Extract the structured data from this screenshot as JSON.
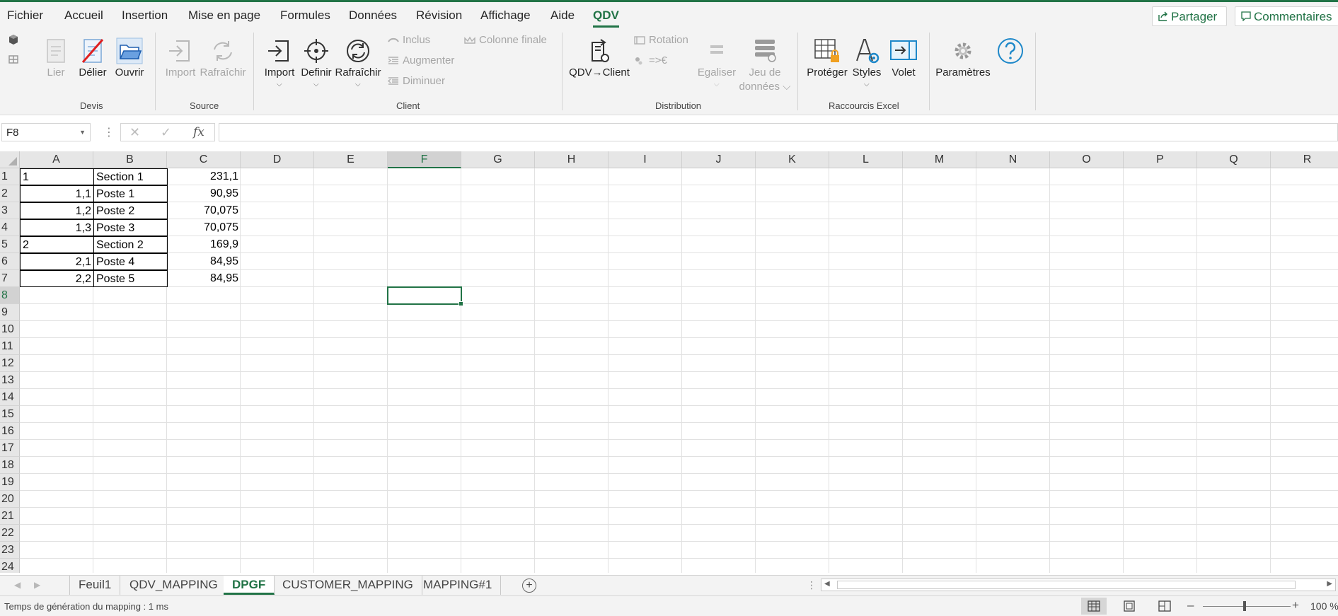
{
  "menubar": {
    "tabs": [
      "Fichier",
      "Accueil",
      "Insertion",
      "Mise en page",
      "Formules",
      "Données",
      "Révision",
      "Affichage",
      "Aide",
      "QDV"
    ],
    "active_tab": "QDV",
    "share_label": "Partager",
    "comments_label": "Commentaires"
  },
  "ribbon": {
    "groups": {
      "devis": "Devis",
      "source": "Source",
      "client": "Client",
      "distribution": "Distribution",
      "raccourcis": "Raccourcis Excel"
    },
    "buttons": {
      "lier": "Lier",
      "delier": "Délier",
      "ouvrir": "Ouvrir",
      "import_source": "Import",
      "rafraichir_source": "Rafraîchir",
      "import_client": "Import",
      "definir": "Definir",
      "rafraichir_client": "Rafraîchir",
      "inclus": "Inclus",
      "augmenter": "Augmenter",
      "diminuer": "Diminuer",
      "colonne_finale": "Colonne finale",
      "qdv_client": "QDV→Client",
      "rotation": "Rotation",
      "currency": "=>€",
      "egaliser": "Egaliser",
      "jeu_de": "Jeu de",
      "donnees": "données",
      "proteger": "Protéger",
      "styles": "Styles",
      "volet": "Volet",
      "parametres": "Paramètres"
    }
  },
  "formula_bar": {
    "name_box": "F8",
    "fx": "fx",
    "formula": ""
  },
  "grid": {
    "columns": [
      "A",
      "B",
      "C",
      "D",
      "E",
      "F",
      "G",
      "H",
      "I",
      "J",
      "K",
      "L",
      "M",
      "N",
      "O",
      "P",
      "Q",
      "R"
    ],
    "selected_column": "F",
    "rows": [
      "1",
      "2",
      "3",
      "4",
      "5",
      "6",
      "7",
      "8",
      "9",
      "10",
      "11",
      "12",
      "13",
      "14",
      "15",
      "16",
      "17",
      "18",
      "19",
      "20",
      "21",
      "22",
      "23",
      "24"
    ],
    "selected_row": "8",
    "data": [
      {
        "a": "1",
        "b": "Section 1",
        "c": "231,1"
      },
      {
        "a": "1,1",
        "b": "Poste 1",
        "c": "90,95"
      },
      {
        "a": "1,2",
        "b": "Poste 2",
        "c": "70,075"
      },
      {
        "a": "1,3",
        "b": "Poste 3",
        "c": "70,075"
      },
      {
        "a": "2",
        "b": "Section 2",
        "c": "169,9"
      },
      {
        "a": "2,1",
        "b": "Poste 4",
        "c": "84,95"
      },
      {
        "a": "2,2",
        "b": "Poste 5",
        "c": "84,95"
      }
    ]
  },
  "sheets": {
    "tabs": [
      "Feuil1",
      "QDV_MAPPING",
      "DPGF",
      "CUSTOMER_MAPPING",
      "MAPPING#1"
    ],
    "active": "DPGF"
  },
  "statusbar": {
    "message": "Temps de génération du mapping : 1 ms",
    "zoom": "100 %",
    "zoom_fraction": 0.5
  },
  "colors": {
    "accent": "#217346",
    "ribbon_bg": "#f3f3f3",
    "disabled_text": "#a6a6a6",
    "link_blue": "#1e88c9"
  }
}
